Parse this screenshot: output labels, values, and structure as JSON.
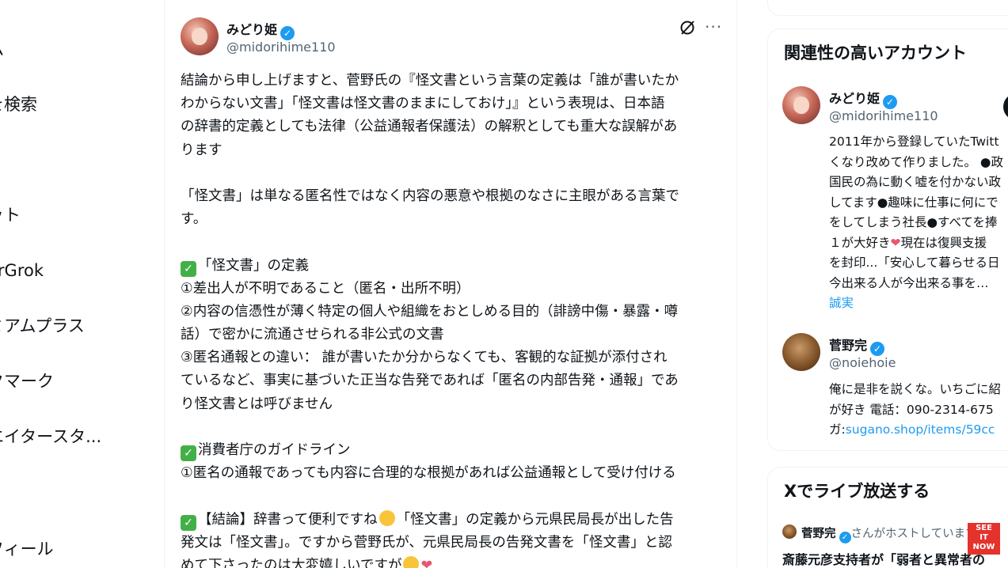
{
  "sidebar": {
    "items": [
      {
        "label": "ム"
      },
      {
        "label": "を検索"
      },
      {
        "label": "ット"
      },
      {
        "label": "erGrok"
      },
      {
        "label": "ミアムプラス"
      },
      {
        "label": "クマーク"
      },
      {
        "label": "エイタースタ..."
      },
      {
        "label": "フィール"
      }
    ]
  },
  "post": {
    "author_name": "みどり姫",
    "author_handle": "@midorihime110",
    "lines": [
      "結論から申し上げますと、菅野氏の『怪文書という言葉の定義は「誰が書いたか",
      "わからない文書」「怪文書は怪文書のままにしておけ」』という表現は、日本語",
      "の辞書的定義としても法律（公益通報者保護法）の解釈としても重大な誤解があ",
      "ります",
      "「怪文書」は単なる匿名性ではなく内容の悪意や根拠のなさに主眼がある言葉で",
      "す。",
      "「怪文書」の定義",
      "①差出人が不明であること（匿名・出所不明）",
      "②内容の信憑性が薄く特定の個人や組織をおとしめる目的（誹謗中傷・暴露・噂",
      "話）で密かに流通させられる非公式の文書",
      "③匿名通報との違い： 誰が書いたか分からなくても、客観的な証拠が添付され",
      "ているなど、事実に基づいた正当な告発であれば「匿名の内部告発・通報」であ",
      "り怪文書とは呼びません",
      "消費者庁のガイドライン",
      "①匿名の通報であっても内容に合理的な根拠があれば公益通報として受け付ける",
      "【結論】辞書って便利ですね",
      "「怪文書」の定義から元県民局長が出した告",
      "発文は「怪文書」。ですから菅野氏が、元県民局長の告発文書を「怪文書」と認",
      "めて下さったのは大変嬉しいですが"
    ]
  },
  "right": {
    "relevant_title": "関連性の高いアカウント",
    "accounts": [
      {
        "name": "みどり姫",
        "handle": "@midorihime110",
        "bio": [
          "2011年から登録していたTwitt",
          "くなり改めて作りました。 ●政",
          "国民の為に動く嘘を付かない政",
          "してます●趣味に仕事に何にで",
          "をしてしまう社長●すべてを捧",
          "１が大好き",
          "現在は復興支援",
          "を封印...「安心して暮らせる日",
          "今出来る人が今出来る事を…",
          "誠実"
        ]
      },
      {
        "name": "菅野完",
        "handle": "@noiehoie",
        "bio": [
          "俺に是非を説くな。いちごに紹",
          "が好き 電話：090-2314-675",
          "ガ:",
          "sugano.shop/items/59cc"
        ]
      }
    ],
    "live_title": "Xでライブ放送する",
    "live_host": "菅野完",
    "live_host_suffix": "さんがホストしています",
    "live_headline": "斎藤元彦支持者が「弱者と異常者の",
    "badge_lines": [
      "SEE",
      "IT",
      "NOW"
    ]
  },
  "colors": {
    "accent": "#1d9bf0",
    "check": "#43b047",
    "heart": "#e8586e",
    "badge": "#e4322d"
  }
}
